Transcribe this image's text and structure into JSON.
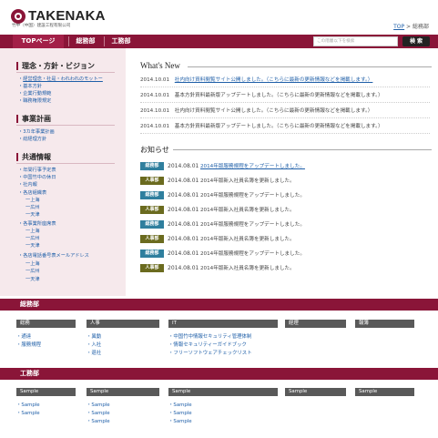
{
  "header": {
    "logo_text": "TAKENAKA",
    "logo_sub": "竹中（中国）建設工程有限公司",
    "breadcrumb_home": "TOP",
    "breadcrumb_sep": " > ",
    "breadcrumb_current": "総務部"
  },
  "nav": {
    "items": [
      "TOPページ",
      "総務部",
      "工務部"
    ],
    "search_placeholder": "この階層以下を検索",
    "search_button": "検 索"
  },
  "sidebar": {
    "sections": [
      {
        "title": "理念・方針・ビジョン",
        "links": [
          "経営理念・社是・われわれのモットー",
          "基本方針",
          "企業行動規範",
          "職務権限規定"
        ]
      },
      {
        "title": "事業計画",
        "links": [
          "3カ年事業計画",
          "総経理方針"
        ]
      },
      {
        "title": "共通情報",
        "links": [
          "年間行事予定表",
          "中国竹中の休日",
          "社内報",
          "各店組織表",
          "一上海",
          "一広州",
          "一天津",
          "各事業所座席表",
          "一上海",
          "一広州",
          "一天津",
          "各店電話番号表メールアドレス",
          "一上海",
          "一広州",
          "一天津"
        ]
      }
    ]
  },
  "whats_new": {
    "title": "What's New",
    "items": [
      {
        "date": "2014.10.01",
        "text": "社内向け資料閲覧サイト公開しました。（こちらに最新の更新情報などを掲載します。）",
        "link": true
      },
      {
        "date": "2014.10.01",
        "text": "基本方針資料最新版アップデートしました。（こちらに最新の更新情報などを掲載します。）",
        "link": false
      },
      {
        "date": "2014.10.01",
        "text": "社内向け資料閲覧サイト公開しました。（こちらに最新の更新情報などを掲載します。）",
        "link": false
      },
      {
        "date": "2014.10.01",
        "text": "基本方針資料最新版アップデートしました。（こちらに最新の更新情報などを掲載します。）",
        "link": false
      }
    ]
  },
  "notices": {
    "title": "お知らせ",
    "items": [
      {
        "tag": "総務部",
        "tag_color": "#2f7f9e",
        "date": "2014.08.01",
        "text": "2014年版服務規程をアップデートしました。",
        "link": true
      },
      {
        "tag": "人事部",
        "tag_color": "#6b6b1f",
        "date": "2014.08.01",
        "text": "2014年版新入社員名簿を更新しました。",
        "link": false
      },
      {
        "tag": "総務部",
        "tag_color": "#2f7f9e",
        "date": "2014.08.01",
        "text": "2014年版服務規程をアップデートしました。",
        "link": false
      },
      {
        "tag": "人事部",
        "tag_color": "#6b6b1f",
        "date": "2014.08.01",
        "text": "2014年版新入社員名簿を更新しました。",
        "link": false
      },
      {
        "tag": "総務部",
        "tag_color": "#2f7f9e",
        "date": "2014.08.01",
        "text": "2014年版服務規程をアップデートしました。",
        "link": false
      },
      {
        "tag": "人事部",
        "tag_color": "#6b6b1f",
        "date": "2014.08.01",
        "text": "2014年版新入社員名簿を更新しました。",
        "link": false
      },
      {
        "tag": "総務部",
        "tag_color": "#2f7f9e",
        "date": "2014.08.01",
        "text": "2014年版服務規程をアップデートしました。",
        "link": false
      },
      {
        "tag": "人事部",
        "tag_color": "#6b6b1f",
        "date": "2014.08.01",
        "text": "2014年版新入社員名簿を更新しました。",
        "link": false
      }
    ]
  },
  "soumu": {
    "title": "総務部",
    "columns": [
      {
        "head": "総務",
        "links": [
          "通達",
          "服務規程"
        ]
      },
      {
        "head": "人事",
        "links": [
          "異動",
          "入社",
          "退社"
        ]
      },
      {
        "head": "IT",
        "links": [
          "中国竹中情報セキュリティ管理体制",
          "情報セキュリティーガイドブック",
          "フリーソフトウェアチェックリスト"
        ]
      },
      {
        "head": "経理",
        "links": []
      },
      {
        "head": "報薄",
        "links": []
      }
    ]
  },
  "koumu": {
    "title": "工務部",
    "columns": [
      {
        "head": "Sample",
        "links": [
          "Sample",
          "Sample"
        ]
      },
      {
        "head": "Sample",
        "links": [
          "Sample",
          "Sample",
          "Sample"
        ]
      },
      {
        "head": "Sample",
        "links": [
          "Sample",
          "Sample",
          "Sample"
        ]
      },
      {
        "head": "Sample",
        "links": []
      },
      {
        "head": "Sample",
        "links": []
      }
    ]
  },
  "colors": {
    "brand": "#8a1538",
    "sidebar_bg": "#f6e9ec",
    "link": "#1f5fa8",
    "column_head": "#595959"
  }
}
